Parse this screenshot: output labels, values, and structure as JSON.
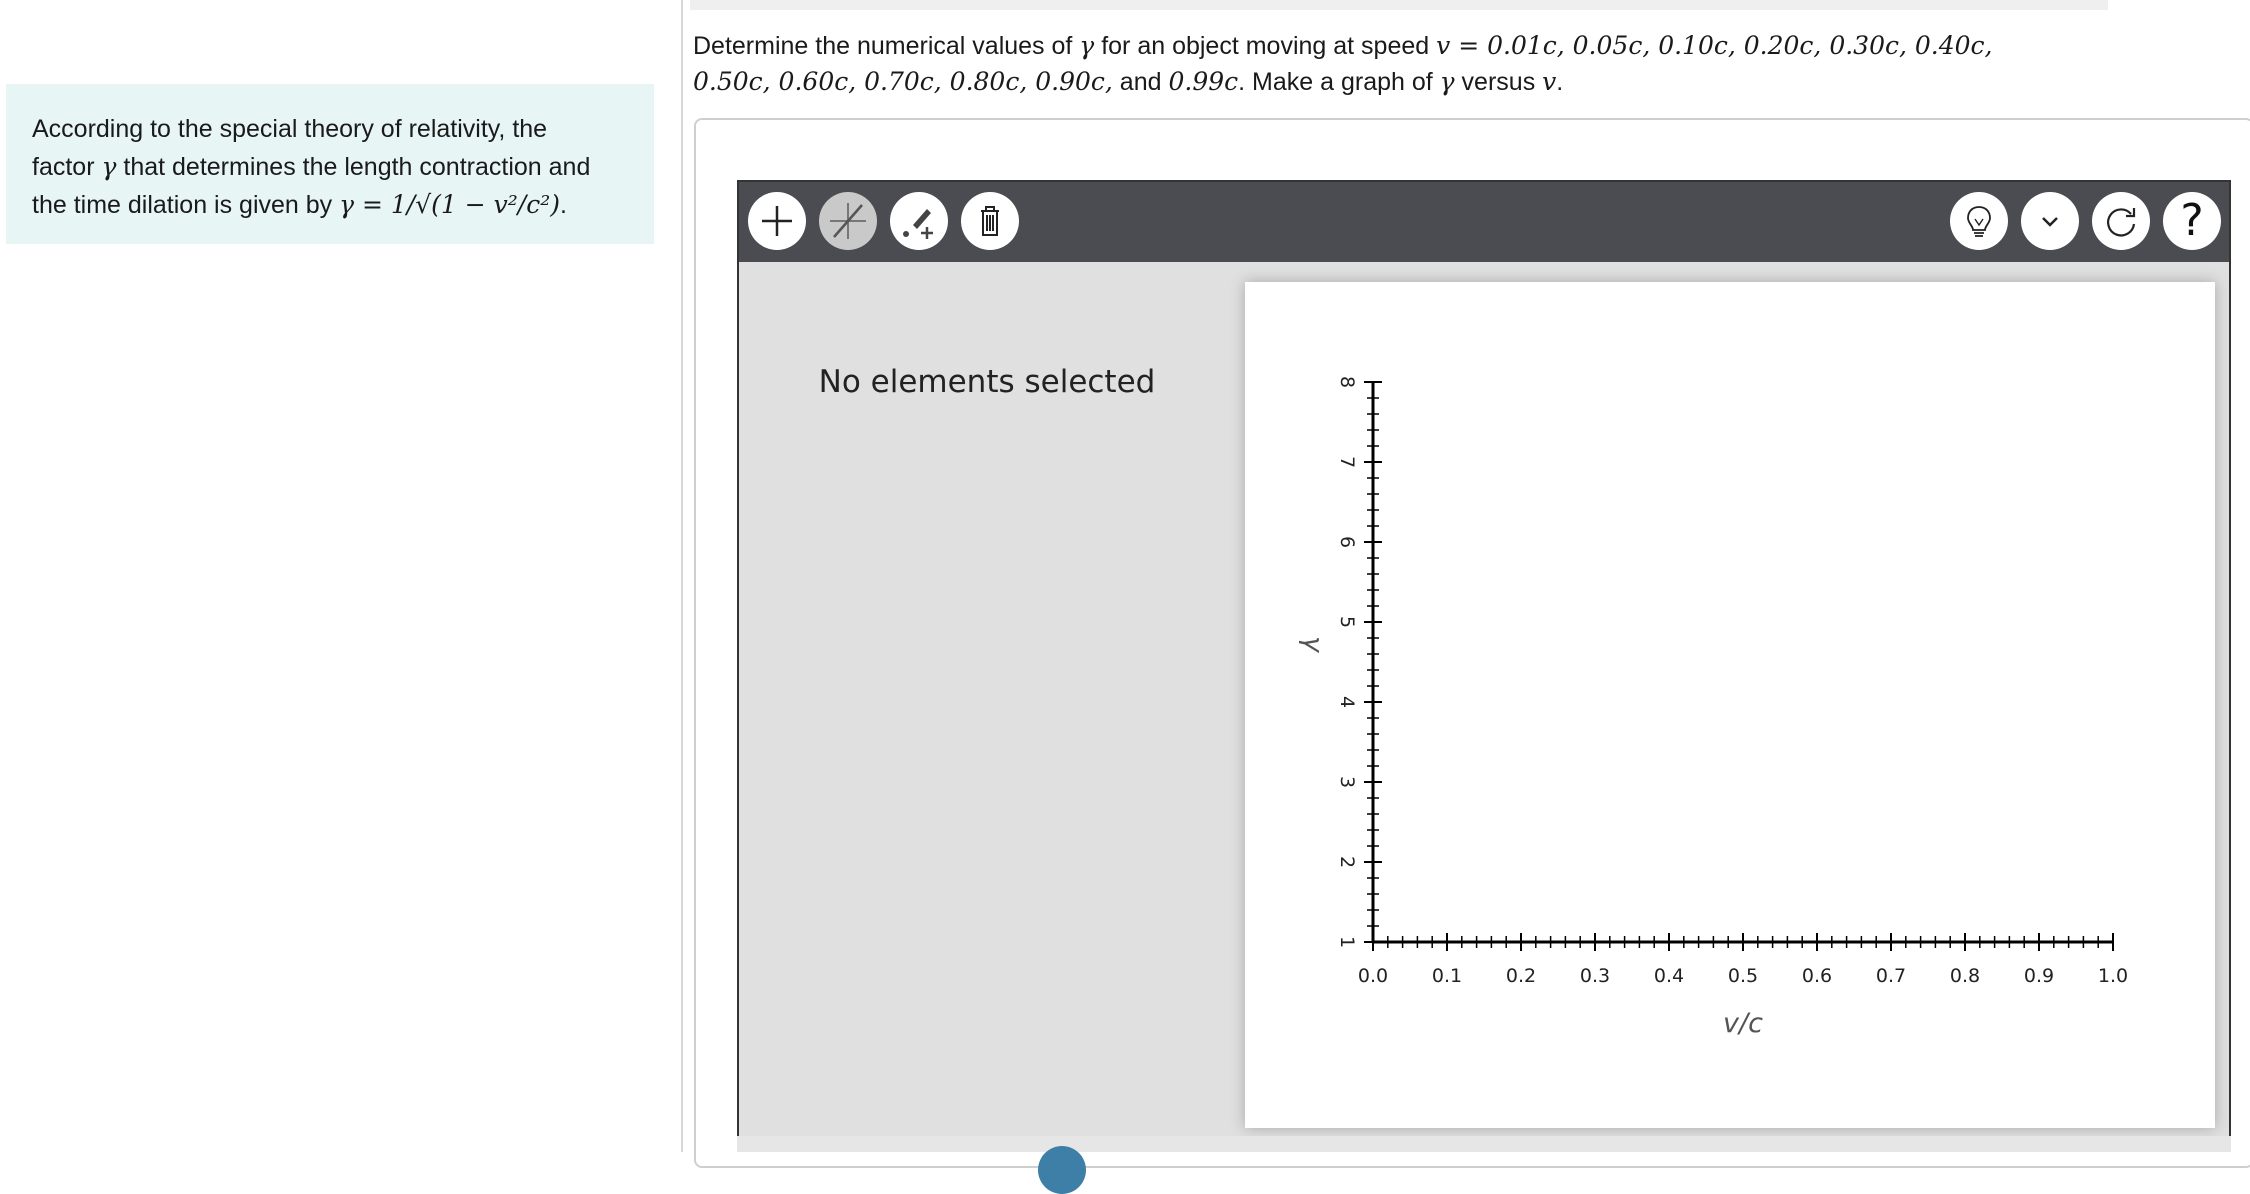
{
  "hint": {
    "line1": "According to the special theory of relativity, the",
    "line2_pre": "factor ",
    "gamma": "γ",
    "line2_post": " that determines the length contraction and",
    "line3_pre": "the time dilation is given by ",
    "formula": "γ = 1/√(1 − v²/c²)",
    "line3_post": "."
  },
  "question": {
    "part1": "Determine the numerical values of ",
    "gamma": "γ",
    "part2": " for an object moving at speed ",
    "speeds_line1": "v = 0.01c, 0.05c, 0.10c, 0.20c, 0.30c, 0.40c,",
    "speeds_line2": "0.50c, 0.60c, 0.70c, 0.80c, 0.90c,",
    "part3": " and ",
    "last_speed": "0.99c",
    "part4": ". Make a graph of ",
    "gamma2": "γ",
    "part5": " versus ",
    "v": "v",
    "part6": "."
  },
  "toolbar": {
    "left_icons": [
      "plus-icon",
      "line-tool-icon",
      "point-pencil-icon",
      "trash-icon"
    ],
    "right_icons": [
      "lightbulb-icon",
      "chevron-down-icon",
      "reset-icon",
      "help-icon"
    ],
    "help_glyph": "?",
    "colors": {
      "bar": "#4a4c52",
      "button": "#ffffff",
      "button_disabled": "#c9c9c9"
    }
  },
  "side_panel": {
    "message": "No elements selected"
  },
  "chart_data": {
    "type": "scatter",
    "xlabel": "v/c",
    "ylabel": "γ",
    "xlim": [
      0.0,
      1.0
    ],
    "ylim": [
      1,
      8
    ],
    "x_ticks": [
      "0.0",
      "0.1",
      "0.2",
      "0.3",
      "0.4",
      "0.5",
      "0.6",
      "0.7",
      "0.8",
      "0.9",
      "1.0"
    ],
    "y_ticks": [
      "1",
      "2",
      "3",
      "4",
      "5",
      "6",
      "7",
      "8"
    ],
    "series": [],
    "grid": false
  }
}
